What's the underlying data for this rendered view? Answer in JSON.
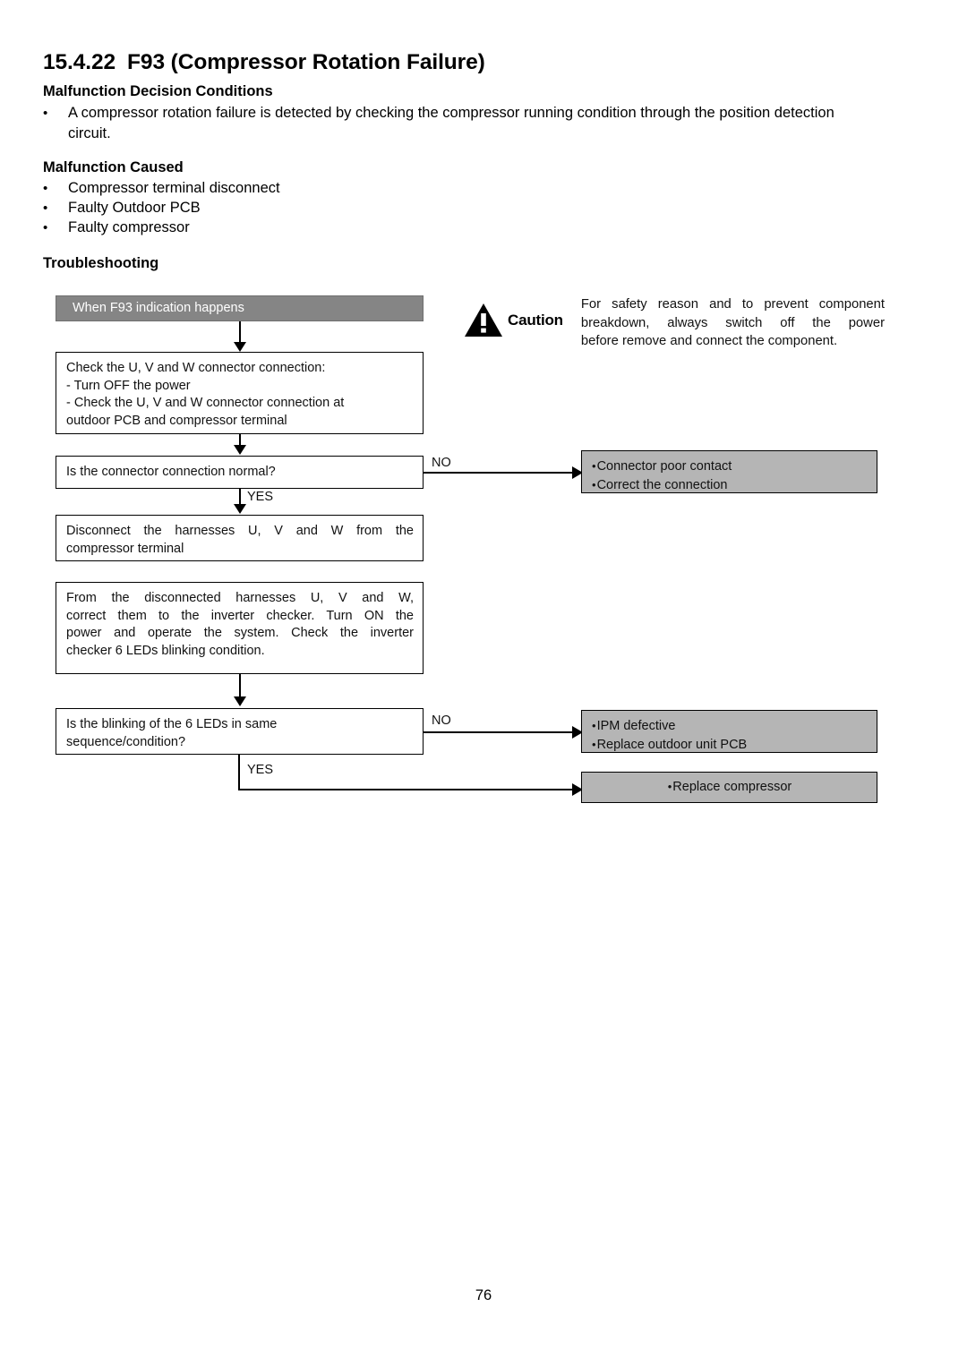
{
  "document": {
    "section_number": "15.4.22",
    "section_title": "F93 (Compressor Rotation Failure)",
    "page_number": "76"
  },
  "headings": {
    "decision_conditions": "Malfunction Decision Conditions",
    "malfunction_caused": "Malfunction Caused",
    "troubleshooting": "Troubleshooting"
  },
  "decision_conditions": {
    "bullet": "•",
    "text": "A compressor rotation failure is detected by checking the compressor running condition through the position detection circuit."
  },
  "malfunction_caused": {
    "bullet": "•",
    "items": [
      "Compressor terminal disconnect",
      "Faulty Outdoor PCB",
      "Faulty compressor"
    ]
  },
  "caution": {
    "icon": "warning-triangle-icon",
    "label": "Caution",
    "line1": "For safety reason and to prevent component",
    "line2": "breakdown, always switch off the power",
    "line3": "before remove and connect the component."
  },
  "flowchart": {
    "start": {
      "label": "When F93 indication happens"
    },
    "step_check_connector": {
      "line1": "Check the U, V and W connector connection:",
      "line2": "-  Turn OFF the power",
      "line3": "-  Check the U, V and W connector connection at",
      "line4": "outdoor PCB and compressor terminal"
    },
    "decision_connector": {
      "question": "Is the connector connection normal?",
      "no_label": "NO",
      "yes_label": "YES"
    },
    "result_connector_no": {
      "bullet": "•",
      "line1": "Connector poor contact",
      "line2": "Correct the connection"
    },
    "step_disconnect": {
      "line1": "Disconnect the harnesses U, V and W from the",
      "line2": "compressor terminal"
    },
    "step_inverter_checker": {
      "line1": "From the disconnected harnesses U, V and W,",
      "line2": "correct them to the inverter checker. Turn ON the",
      "line3": "power and operate the system. Check the inverter",
      "line4": "checker 6 LEDs blinking condition."
    },
    "decision_leds": {
      "question_line1": "Is   the   blinking   of   the   6   LEDs   in   same",
      "question_line2": "sequence/condition?",
      "no_label": "NO",
      "yes_label": "YES"
    },
    "result_leds_no": {
      "bullet": "•",
      "line1": "IPM defective",
      "line2": "Replace outdoor unit PCB"
    },
    "result_leds_yes": {
      "bullet": "•",
      "line1": "Replace compressor"
    }
  },
  "colors": {
    "header_box": "#858585",
    "result_box": "#b5b5b5",
    "line": "#000000"
  }
}
